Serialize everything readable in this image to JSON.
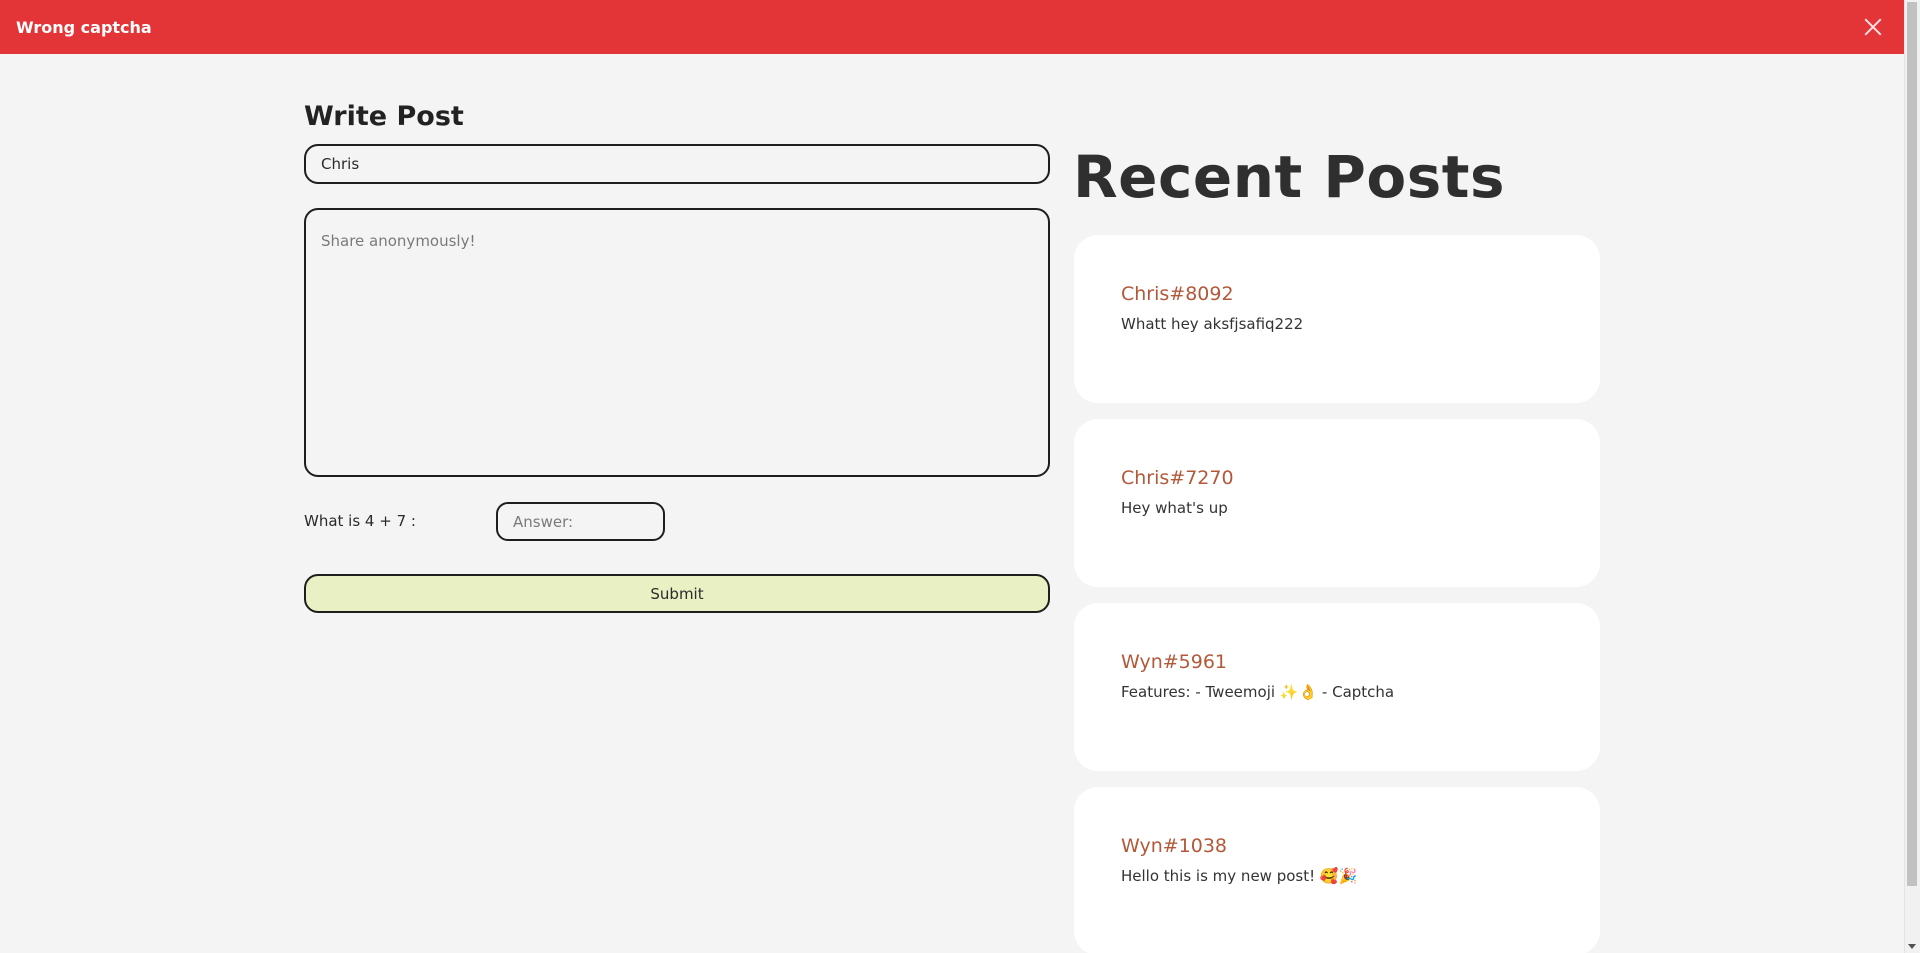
{
  "alert": {
    "message": "Wrong captcha",
    "close_icon": "close-icon"
  },
  "write": {
    "title": "Write Post",
    "name_value": "Chris",
    "text_placeholder": "Share anonymously!",
    "captcha_label": "What is 4 + 7 :",
    "captcha_placeholder": "Answer:",
    "submit_label": "Submit"
  },
  "recent": {
    "title": "Recent Posts",
    "posts": [
      {
        "author": "Chris#8092",
        "body": "Whatt hey aksfjsafiq222"
      },
      {
        "author": "Chris#7270",
        "body": "Hey what's up"
      },
      {
        "author": "Wyn#5961",
        "body": "Features: - Tweemoji ✨👌 - Captcha"
      },
      {
        "author": "Wyn#1038",
        "body": "Hello this is my new post! 🥰🎉"
      }
    ]
  },
  "colors": {
    "alert": "#e33537",
    "author": "#b3593a",
    "submit": "#e8f0c4"
  }
}
